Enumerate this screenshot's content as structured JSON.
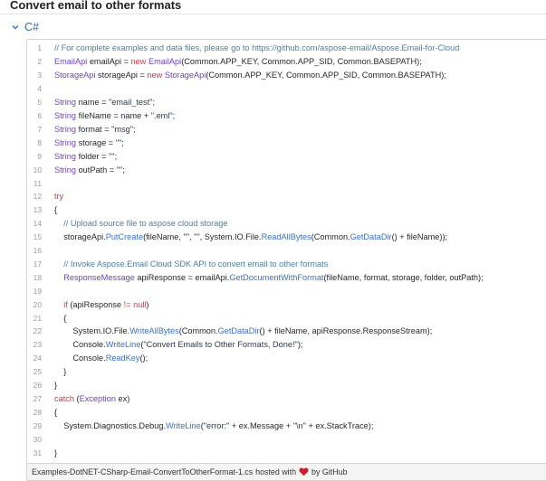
{
  "page": {
    "title": "Convert email to other formats"
  },
  "language_tab": {
    "label": "C#",
    "icon": "chevron-down-icon"
  },
  "colors": {
    "comment": "#4d7fa7",
    "keyword": "#d73a49",
    "type": "#6f42c1",
    "method": "#3b6fd1",
    "string": "#2a3b52",
    "heart": "#c8202e"
  },
  "code": {
    "lines": [
      {
        "num": "1",
        "tokens": [
          {
            "t": "// For complete examples and data files, please go to https://github.com/aspose-email/Aspose.Email-for-Cloud",
            "c": "comment"
          }
        ]
      },
      {
        "num": "2",
        "tokens": [
          {
            "t": "EmailApi",
            "c": "type"
          },
          {
            "t": " emailApi = "
          },
          {
            "t": "new",
            "c": "keyword"
          },
          {
            "t": " "
          },
          {
            "t": "EmailApi",
            "c": "type"
          },
          {
            "t": "(Common.APP_KEY, Common.APP_SID, Common.BASEPATH);"
          }
        ]
      },
      {
        "num": "3",
        "tokens": [
          {
            "t": "StorageApi",
            "c": "type"
          },
          {
            "t": " storageApi = "
          },
          {
            "t": "new",
            "c": "keyword"
          },
          {
            "t": " "
          },
          {
            "t": "StorageApi",
            "c": "type"
          },
          {
            "t": "(Common.APP_KEY, Common.APP_SID, Common.BASEPATH);"
          }
        ]
      },
      {
        "num": "4",
        "tokens": []
      },
      {
        "num": "5",
        "tokens": [
          {
            "t": "String",
            "c": "type"
          },
          {
            "t": " name = "
          },
          {
            "t": "\"email_test\"",
            "c": "string"
          },
          {
            "t": ";"
          }
        ]
      },
      {
        "num": "6",
        "tokens": [
          {
            "t": "String",
            "c": "type"
          },
          {
            "t": " fileName = name + "
          },
          {
            "t": "\".eml\"",
            "c": "string"
          },
          {
            "t": ";"
          }
        ]
      },
      {
        "num": "7",
        "tokens": [
          {
            "t": "String",
            "c": "type"
          },
          {
            "t": " format = "
          },
          {
            "t": "\"msg\"",
            "c": "string"
          },
          {
            "t": ";"
          }
        ]
      },
      {
        "num": "8",
        "tokens": [
          {
            "t": "String",
            "c": "type"
          },
          {
            "t": " storage = "
          },
          {
            "t": "\"\"",
            "c": "string"
          },
          {
            "t": ";"
          }
        ]
      },
      {
        "num": "9",
        "tokens": [
          {
            "t": "String",
            "c": "type"
          },
          {
            "t": " folder = "
          },
          {
            "t": "\"\"",
            "c": "string"
          },
          {
            "t": ";"
          }
        ]
      },
      {
        "num": "10",
        "tokens": [
          {
            "t": "String",
            "c": "type"
          },
          {
            "t": " outPath = "
          },
          {
            "t": "\"\"",
            "c": "string"
          },
          {
            "t": ";"
          }
        ]
      },
      {
        "num": "11",
        "tokens": []
      },
      {
        "num": "12",
        "tokens": [
          {
            "t": "try",
            "c": "keyword"
          }
        ]
      },
      {
        "num": "13",
        "tokens": [
          {
            "t": "{"
          }
        ]
      },
      {
        "num": "14",
        "tokens": [
          {
            "t": "    "
          },
          {
            "t": "// Upload source file to aspose cloud storage",
            "c": "comment"
          }
        ]
      },
      {
        "num": "15",
        "tokens": [
          {
            "t": "    storageApi."
          },
          {
            "t": "PutCreate",
            "c": "method"
          },
          {
            "t": "(fileName, "
          },
          {
            "t": "\"\"",
            "c": "string"
          },
          {
            "t": ", "
          },
          {
            "t": "\"\"",
            "c": "string"
          },
          {
            "t": ", System.IO.File."
          },
          {
            "t": "ReadAllBytes",
            "c": "method"
          },
          {
            "t": "(Common."
          },
          {
            "t": "GetDataDir",
            "c": "method"
          },
          {
            "t": "() + fileName));"
          }
        ]
      },
      {
        "num": "16",
        "tokens": []
      },
      {
        "num": "17",
        "tokens": [
          {
            "t": "    "
          },
          {
            "t": "// Invoke Aspose.Email Cloud SDK API to convert email to other formats",
            "c": "comment"
          }
        ]
      },
      {
        "num": "18",
        "tokens": [
          {
            "t": "    "
          },
          {
            "t": "ResponseMessage",
            "c": "type"
          },
          {
            "t": " apiResponse = emailApi."
          },
          {
            "t": "GetDocumentWithFormat",
            "c": "method"
          },
          {
            "t": "(fileName, format, storage, folder, outPath);"
          }
        ]
      },
      {
        "num": "19",
        "tokens": []
      },
      {
        "num": "20",
        "tokens": [
          {
            "t": "    "
          },
          {
            "t": "if",
            "c": "keyword"
          },
          {
            "t": " (apiResponse "
          },
          {
            "t": "!=",
            "c": "keyword"
          },
          {
            "t": " "
          },
          {
            "t": "null",
            "c": "keyword"
          },
          {
            "t": ")"
          }
        ]
      },
      {
        "num": "21",
        "tokens": [
          {
            "t": "    {"
          }
        ]
      },
      {
        "num": "22",
        "tokens": [
          {
            "t": "        System.IO.File."
          },
          {
            "t": "WriteAllBytes",
            "c": "method"
          },
          {
            "t": "(Common."
          },
          {
            "t": "GetDataDir",
            "c": "method"
          },
          {
            "t": "() + fileName, apiResponse.ResponseStream);"
          }
        ]
      },
      {
        "num": "23",
        "tokens": [
          {
            "t": "        Console."
          },
          {
            "t": "WriteLine",
            "c": "method"
          },
          {
            "t": "("
          },
          {
            "t": "\"Convert Emails to Other Formats, Done!\"",
            "c": "string"
          },
          {
            "t": ");"
          }
        ]
      },
      {
        "num": "24",
        "tokens": [
          {
            "t": "        Console."
          },
          {
            "t": "ReadKey",
            "c": "method"
          },
          {
            "t": "();"
          }
        ]
      },
      {
        "num": "25",
        "tokens": [
          {
            "t": "    }"
          }
        ]
      },
      {
        "num": "26",
        "tokens": [
          {
            "t": "}"
          }
        ]
      },
      {
        "num": "27",
        "tokens": [
          {
            "t": "catch",
            "c": "keyword"
          },
          {
            "t": " ("
          },
          {
            "t": "Exception",
            "c": "type"
          },
          {
            "t": " ex)"
          }
        ]
      },
      {
        "num": "28",
        "tokens": [
          {
            "t": "{"
          }
        ]
      },
      {
        "num": "29",
        "tokens": [
          {
            "t": "    System.Diagnostics.Debug."
          },
          {
            "t": "WriteLine",
            "c": "method"
          },
          {
            "t": "("
          },
          {
            "t": "\"error:\"",
            "c": "string"
          },
          {
            "t": " + ex.Message + "
          },
          {
            "t": "\"\\n\"",
            "c": "string"
          },
          {
            "t": " + ex.StackTrace);"
          }
        ]
      },
      {
        "num": "30",
        "tokens": []
      },
      {
        "num": "31",
        "tokens": [
          {
            "t": "}"
          }
        ]
      }
    ]
  },
  "footer": {
    "filename": "Examples-DotNET-CSharp-Email-ConvertToOtherFormat-1.cs",
    "hosted_text": "hosted with",
    "by_text": "by GitHub",
    "heart_icon": "heart-icon"
  }
}
